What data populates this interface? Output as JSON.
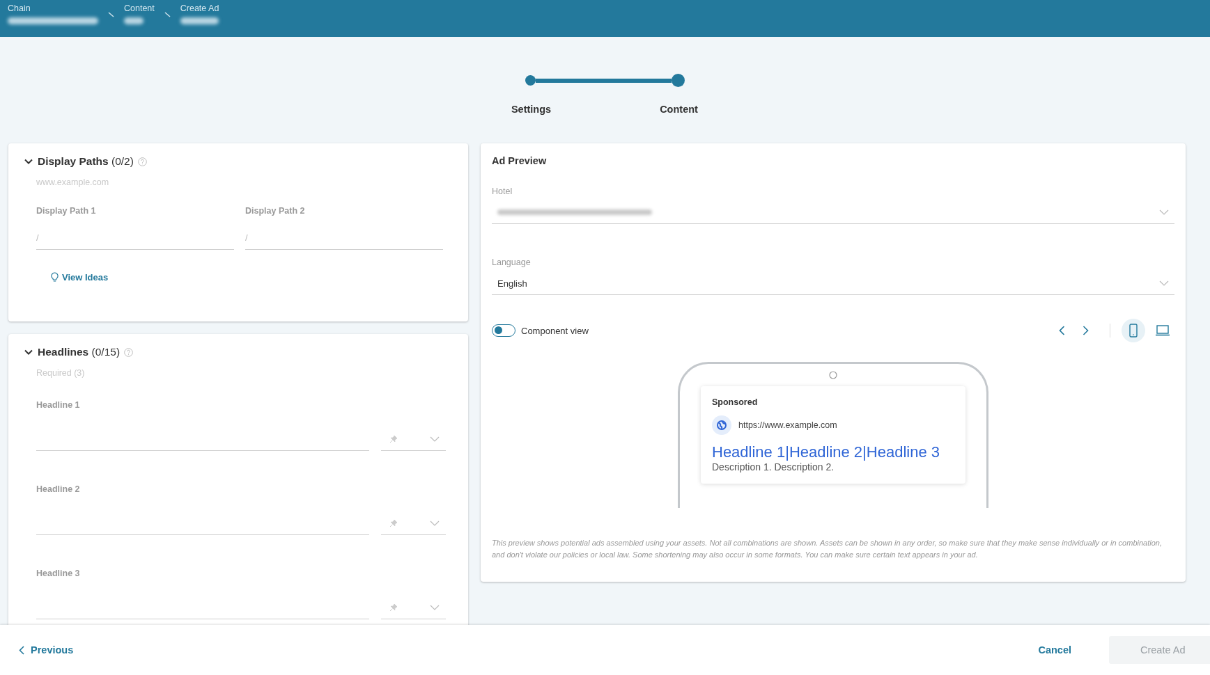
{
  "breadcrumbs": [
    {
      "label": "Chain"
    },
    {
      "label": "Content"
    },
    {
      "label": "Create Ad"
    }
  ],
  "stepper": {
    "level": 1,
    "steps": [
      {
        "label": "Settings",
        "done": true
      },
      {
        "label": "Content",
        "done": true
      }
    ]
  },
  "display_paths": {
    "title": "Display Paths",
    "count": "(0/2)",
    "expanded": true,
    "hint": "www.example.com",
    "fields": [
      {
        "label": "Display Path 1",
        "placeholder": "/"
      },
      {
        "label": "Display Path 2",
        "placeholder": "/"
      }
    ],
    "link": "View Ideas"
  },
  "headlines": {
    "title": "Headlines",
    "count": "(0/15)",
    "expanded": true,
    "hint": "Required (3)",
    "fields": [
      {
        "label": "Headline 1"
      },
      {
        "label": "Headline 2"
      },
      {
        "label": "Headline 3"
      }
    ]
  },
  "ad_preview": {
    "title": "Ad Preview",
    "hotel": {
      "label": "Hotel"
    },
    "language": {
      "label": "Language",
      "value": "English"
    },
    "component_view": {
      "label": "Component view",
      "on": false
    },
    "devices": [
      {
        "kind": "mobile",
        "selected": true
      },
      {
        "kind": "desktop",
        "selected": false
      }
    ],
    "ad": {
      "sponsored": "Sponsored",
      "url": "https://www.example.com",
      "headline": "Headline 1|Headline 2|Headline 3",
      "description": "Description 1. Description 2."
    },
    "disclaimer": "This preview shows potential ads assembled using your assets. Not all combinations are shown. Assets can be shown in any order, so make sure that they make sense individually or in combination, and don't violate our policies or local law. Some shortening may also occur in some formats. You can make sure certain text appears in your ad."
  },
  "footer": {
    "previous": "Previous",
    "cancel": "Cancel",
    "create": {
      "label": "Create Ad",
      "disabled": true
    }
  }
}
